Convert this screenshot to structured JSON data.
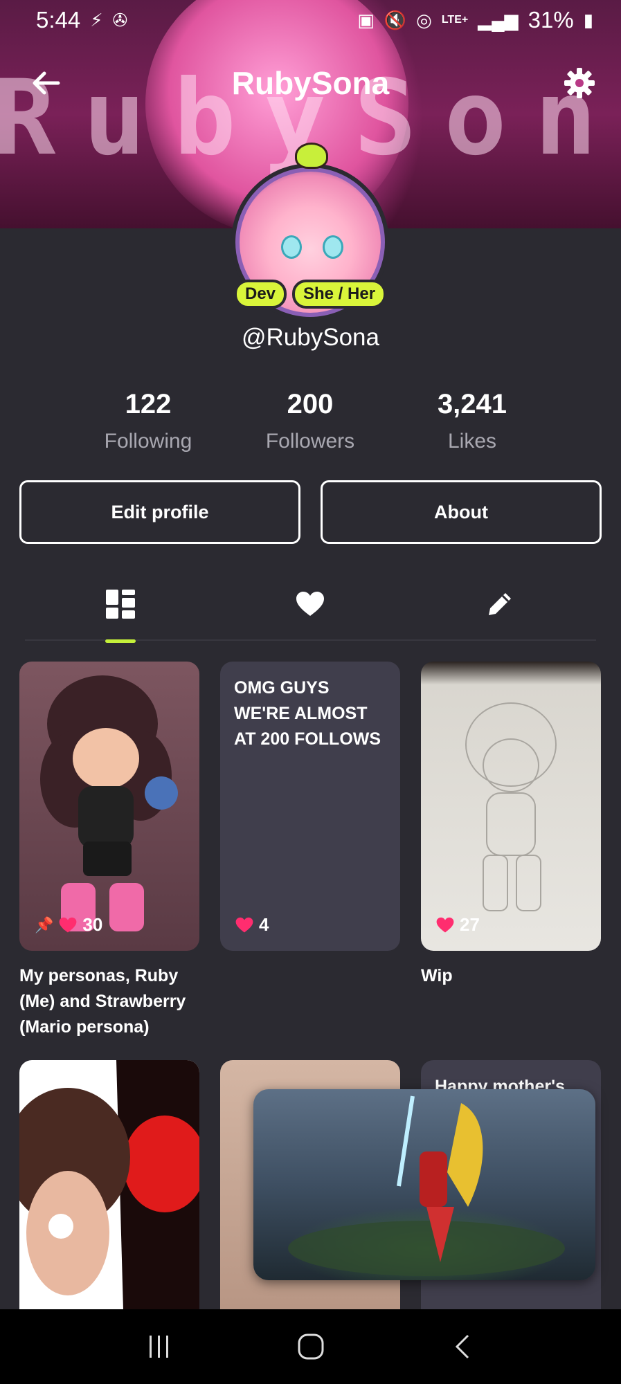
{
  "status_bar": {
    "time": "5:44",
    "network": "LTE+",
    "battery": "31%"
  },
  "header": {
    "title": "RubySona",
    "banner_text": "RubySona"
  },
  "profile": {
    "badges": [
      "Dev",
      "She / Her"
    ],
    "username": "@RubySona"
  },
  "stats": [
    {
      "value": "122",
      "label": "Following"
    },
    {
      "value": "200",
      "label": "Followers"
    },
    {
      "value": "3,241",
      "label": "Likes"
    }
  ],
  "actions": {
    "edit_label": "Edit profile",
    "about_label": "About"
  },
  "tabs": [
    {
      "icon": "grid-icon",
      "active": true
    },
    {
      "icon": "heart-icon",
      "active": false
    },
    {
      "icon": "pencil-icon",
      "active": false
    }
  ],
  "posts": [
    {
      "text": "",
      "likes": "30",
      "pinned": true,
      "caption": "My personas, Ruby (Me) and Strawberry (Mario persona)"
    },
    {
      "text": "OMG GUYS WE'RE ALMOST AT 200 FOLLOWS",
      "likes": "4",
      "pinned": false,
      "caption": ""
    },
    {
      "text": "",
      "likes": "27",
      "pinned": false,
      "caption": "Wip"
    },
    {
      "text": "",
      "likes": "",
      "pinned": false,
      "caption": ""
    },
    {
      "text": "",
      "likes": "",
      "pinned": false,
      "caption": ""
    },
    {
      "text": "Happy mother's",
      "likes": "",
      "pinned": false,
      "caption": ""
    }
  ],
  "colors": {
    "accent": "#c4f03a",
    "badge": "#d9f53a",
    "heart": "#ff2d6f",
    "background": "#2b2a31",
    "card": "#403e4c"
  }
}
